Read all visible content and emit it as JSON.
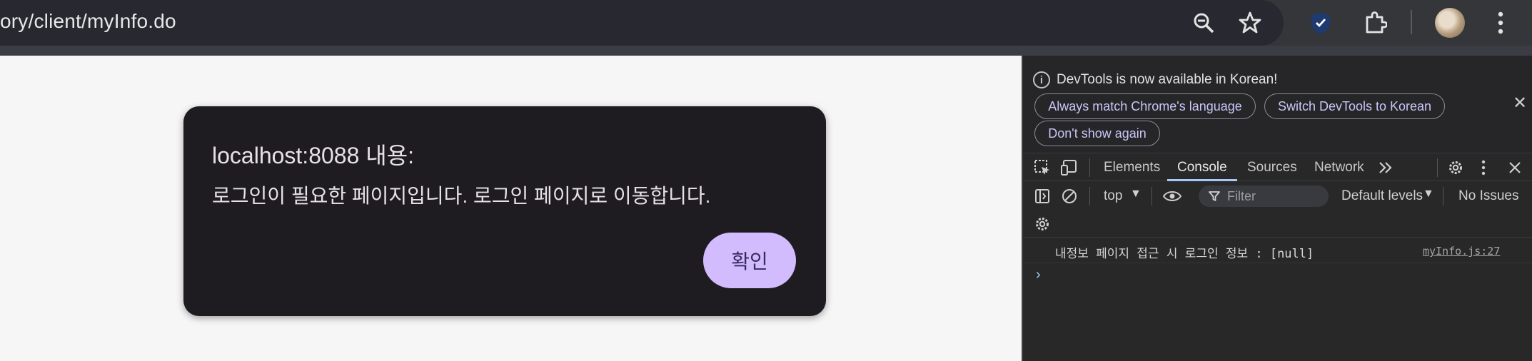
{
  "browser": {
    "url": "ory/client/myInfo.do",
    "icons": [
      "zoom-icon",
      "bookmark-star-icon",
      "extension-check-icon",
      "extensions-puzzle-icon",
      "profile-avatar",
      "browser-menu-icon"
    ]
  },
  "dialog": {
    "title": "localhost:8088 내용:",
    "message": "로그인이 필요한 페이지입니다. 로그인 페이지로 이동합니다.",
    "ok_label": "확인",
    "accent": "#d3bcfd"
  },
  "devtools": {
    "infobar": {
      "text": "DevTools is now available in Korean!",
      "buttons": [
        "Always match Chrome's language",
        "Switch DevTools to Korean",
        "Don't show again"
      ]
    },
    "tabs": [
      "Elements",
      "Console",
      "Sources",
      "Network"
    ],
    "active_tab": "Console",
    "console_toolbar": {
      "context": "top",
      "filter_placeholder": "Filter",
      "levels": "Default levels",
      "issues": "No Issues"
    },
    "log": {
      "message": "내정보 페이지 접근 시 로그인 정보 : [null]",
      "source": "myInfo.js:27"
    },
    "prompt": "›"
  }
}
